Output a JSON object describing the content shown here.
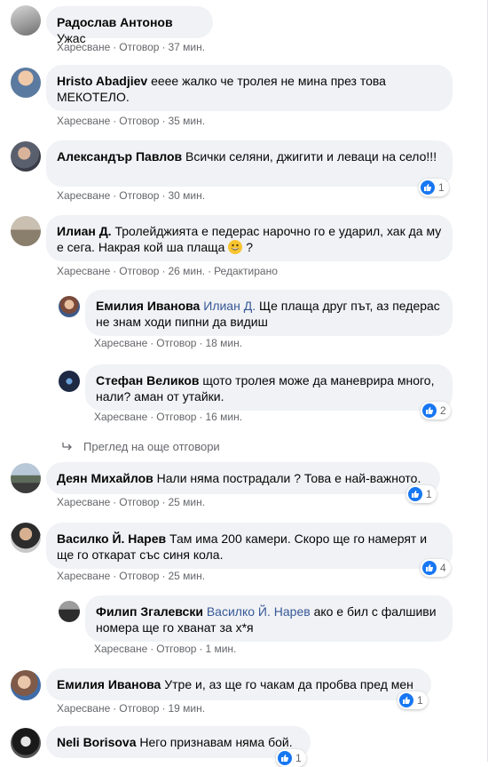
{
  "actions": {
    "like": "Харесване",
    "reply": "Отговор",
    "edited": "Редактирано"
  },
  "comments": [
    {
      "author": "Радослав Антонов",
      "text": "Ужас",
      "time": "37 мин."
    },
    {
      "author": "Hristo Abadjiev",
      "text": "ееее жалко че тролея не мина през това МЕКОТЕЛО.",
      "time": "35 мин."
    },
    {
      "author": "Александър Павлов",
      "text": "Всички селяни, джигити и леваци на село!!!",
      "time": "30 мин.",
      "reactions": "1"
    },
    {
      "author": "Илиан Д.",
      "text_before": "Тролейджията е педерас нарочно го е ударил, хак да му е сега. Накрая кой ша плаща",
      "text_after": " ?",
      "time": "26 мин."
    },
    {
      "author": "Емилия Иванова",
      "mention": "Илиан Д.",
      "text": "Ще плаща друг път, аз педерас не знам ходи пипни да видиш",
      "time": "18 мин."
    },
    {
      "author": "Стефан Великов",
      "text": "щото тролея може да маневрира много, нали? аман от утайки.",
      "time": "16 мин.",
      "reactions": "2"
    },
    {
      "author": "Деян Михайлов",
      "text": "Нали няма пострадали ? Това е най-важното.",
      "time": "25 мин.",
      "reactions": "1"
    },
    {
      "author": "Василко Й. Нарев",
      "text": "Там има 200 камери. Скоро ще го намерят и ще го откарат със синя кола.",
      "time": "25 мин.",
      "reactions": "4"
    },
    {
      "author": "Филип Згалевски",
      "mention": "Василко Й. Нарев",
      "text": "ако е бил с фалшиви номера ще го хванат за х*я",
      "time": "1 мин."
    },
    {
      "author": "Емилия Иванова",
      "text": "Утре и, аз ще го чакам да пробва пред мен",
      "time": "19 мин.",
      "reactions": "1"
    },
    {
      "author": "Neli Borisova",
      "text": "Него признавам няма бой.",
      "reactions": "1"
    }
  ],
  "view_more": "Преглед на още отговори",
  "colors": {
    "bubble": "#f0f2f5",
    "meta": "#65676b",
    "link": "#385898",
    "like": "#1877f2"
  }
}
